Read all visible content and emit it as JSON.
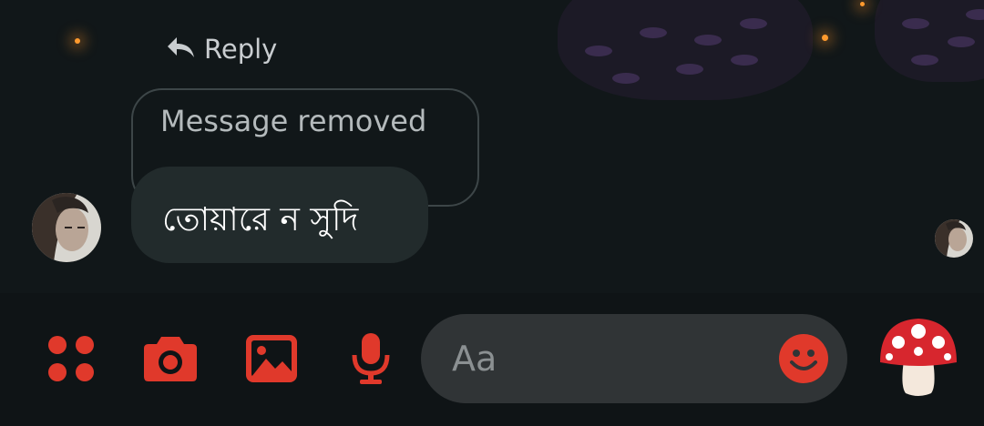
{
  "reply": {
    "label": "Reply",
    "icon": "reply-arrow-icon"
  },
  "removed_message": {
    "text": "Message removed"
  },
  "message": {
    "text": "তোয়ারে ন সুদি"
  },
  "composer": {
    "placeholder": "Aa",
    "accent_color": "#e0392b",
    "tools": [
      "menu-dots-icon",
      "camera-icon",
      "gallery-icon",
      "microphone-icon"
    ],
    "emoji_icon": "smiley-icon",
    "quick_reaction": "mushroom-icon"
  }
}
